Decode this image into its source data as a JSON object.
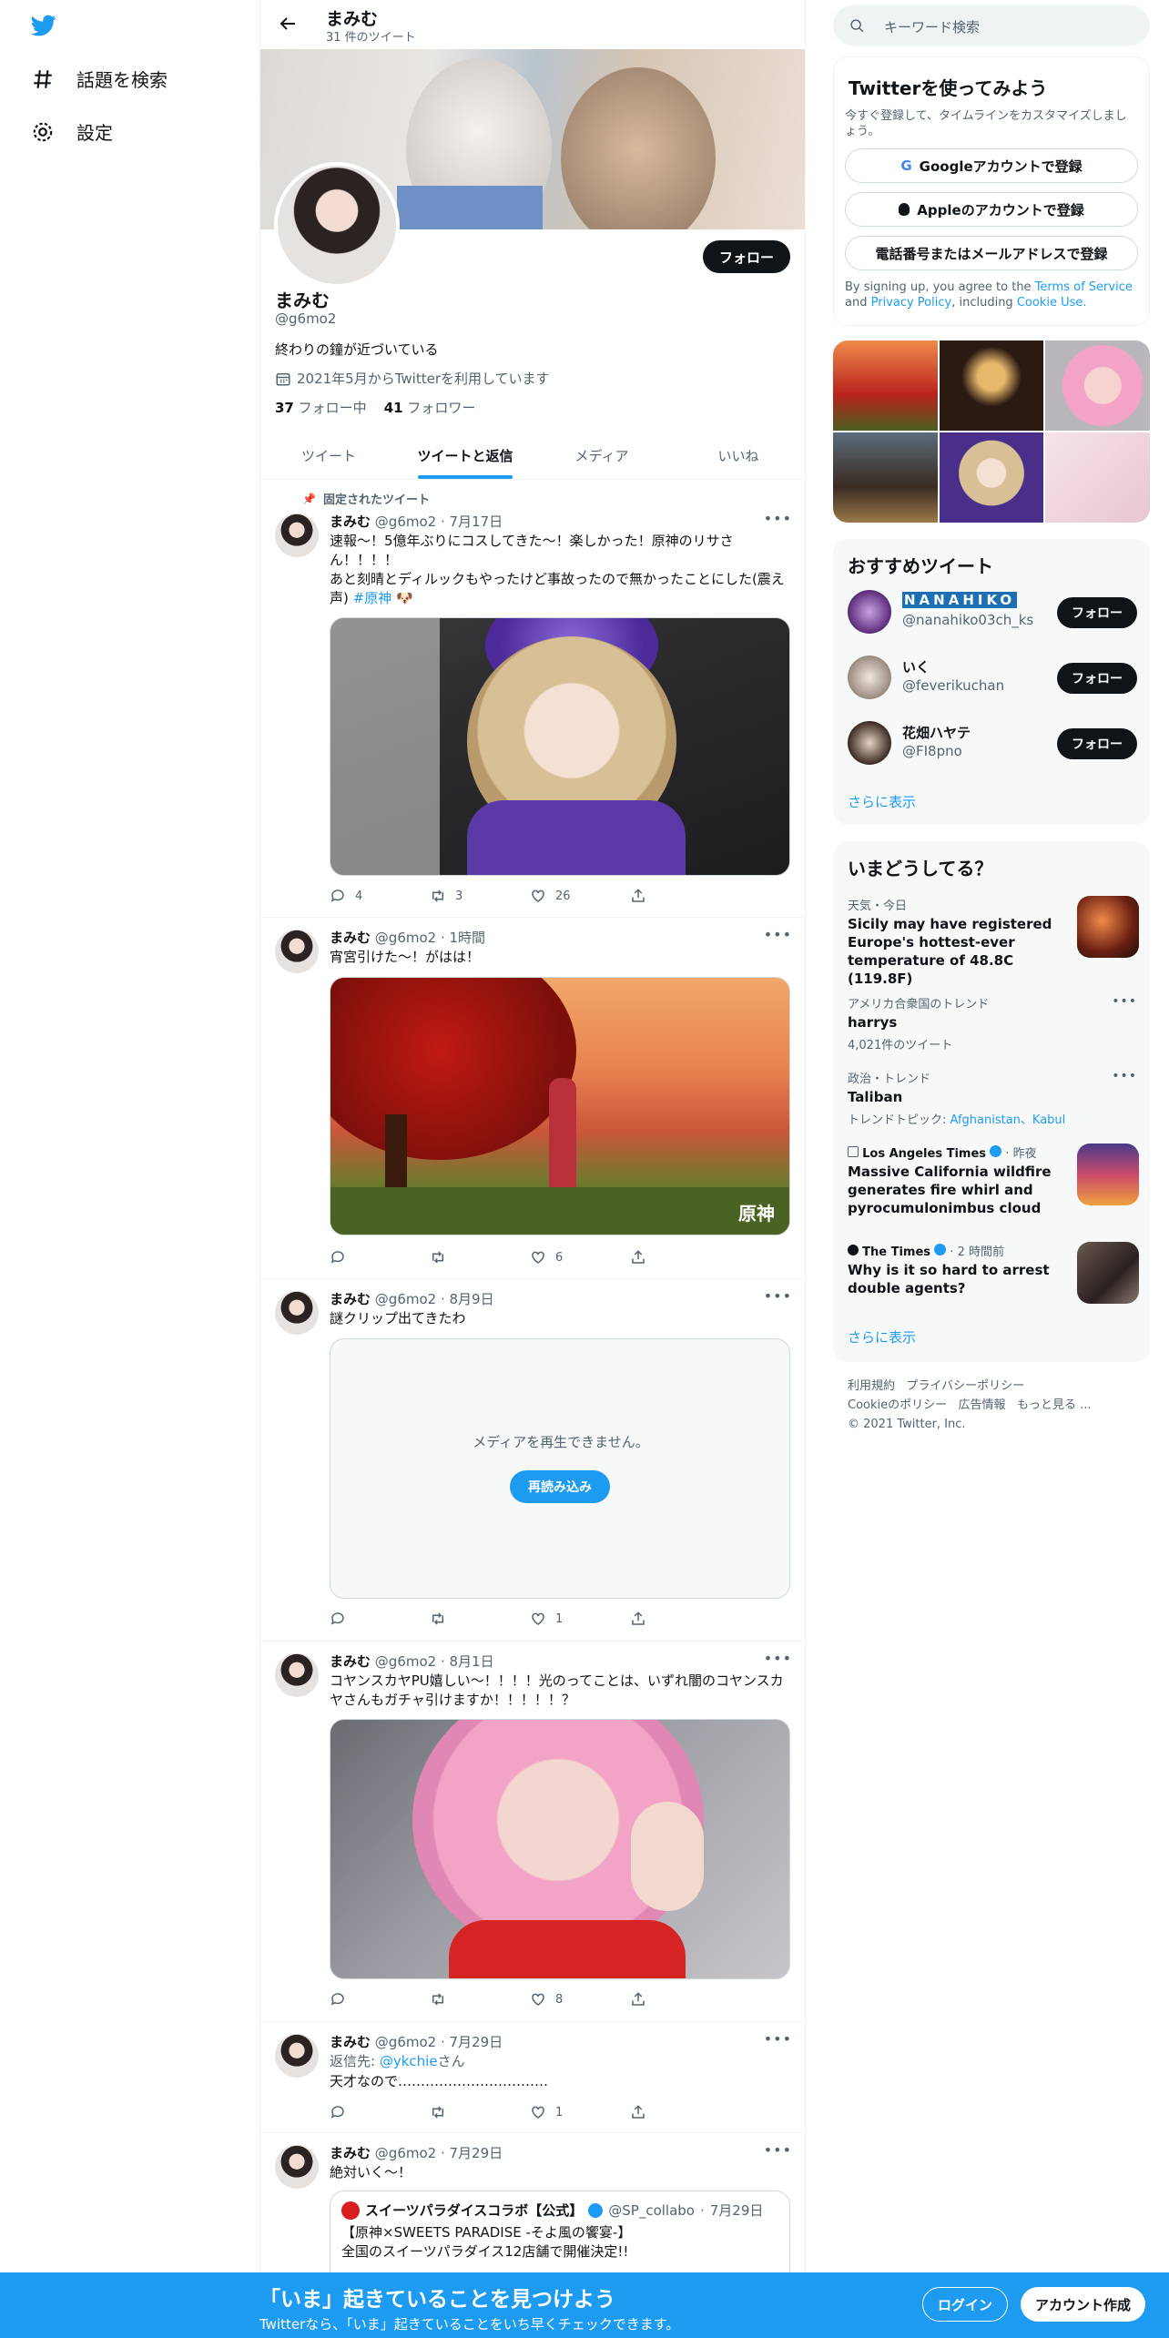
{
  "nav": {
    "explore": "話題を検索",
    "settings": "設定"
  },
  "header": {
    "name": "まみむ",
    "tweet_count": "31 件のツイート"
  },
  "profile": {
    "follow": "フォロー",
    "name": "まみむ",
    "handle": "@g6mo2",
    "bio": "終わりの鐘が近づいている",
    "joined": "2021年5月からTwitterを利用しています",
    "following_count": "37",
    "following_label": "フォロー中",
    "followers_count": "41",
    "followers_label": "フォロワー"
  },
  "tabs": [
    "ツイート",
    "ツイートと返信",
    "メディア",
    "いいね"
  ],
  "pinned_label": "固定されたツイート",
  "tweets": [
    {
      "name": "まみむ",
      "handle": "@g6mo2",
      "time": "7月17日",
      "text1": "速報〜！5億年ぶりにコスしてきた〜！楽しかった！原神のリサさん！！！！",
      "text2": "あと刻晴とディルックもやったけど事故ったので無かったことにした(震え声)",
      "hashtag": "#原神",
      "replies": "4",
      "retweets": "3",
      "likes": "26"
    },
    {
      "name": "まみむ",
      "handle": "@g6mo2",
      "time": "1時間",
      "text": "宵宮引けた〜！がはは！",
      "watermark": "原神",
      "replies": "",
      "retweets": "",
      "likes": "6"
    },
    {
      "name": "まみむ",
      "handle": "@g6mo2",
      "time": "8月9日",
      "text": "謎クリップ出てきたわ",
      "media_error": "メディアを再生できません。",
      "reload": "再読み込み",
      "replies": "",
      "retweets": "",
      "likes": "1"
    },
    {
      "name": "まみむ",
      "handle": "@g6mo2",
      "time": "8月1日",
      "text": "コヤンスカヤPU嬉しい〜！！！！光のってことは、いずれ闇のコヤンスカヤさんもガチャ引けますか！！！！！？",
      "replies": "",
      "retweets": "",
      "likes": "8"
    },
    {
      "name": "まみむ",
      "handle": "@g6mo2",
      "time": "7月29日",
      "reply_to_label": "返信先:",
      "reply_to": "@ykchie",
      "reply_suffix": "さん",
      "text": "天才なので……………………………",
      "replies": "",
      "retweets": "",
      "likes": "1"
    },
    {
      "name": "まみむ",
      "handle": "@g6mo2",
      "time": "7月29日",
      "text": "絶対いく〜！",
      "quote_name": "スイーツパラダイスコラボ【公式】",
      "quote_handle": "@SP_collabo",
      "quote_time": "7月29日",
      "quote_text1": "【原神×SWEETS PARADISE -そよ風の饗宴-】",
      "quote_text2": "全国のスイーツパラダイス12店舗で開催決定!!"
    }
  ],
  "search": {
    "placeholder": "キーワード検索"
  },
  "signup": {
    "title": "Twitterを使ってみよう",
    "subtitle": "今すぐ登録して、タイムラインをカスタマイズしましょう。",
    "google": "Googleアカウントで登録",
    "apple": "Appleのアカウントで登録",
    "phone": "電話番号またはメールアドレスで登録",
    "terms_prefix": "By signing up, you agree to the",
    "terms_link": "Terms of Service",
    "terms_and": "and",
    "privacy_link": "Privacy Policy",
    "terms_including": ", including",
    "cookie_link": "Cookie Use."
  },
  "recommended": {
    "title": "おすすめツイート",
    "follow": "フォロー",
    "users": [
      {
        "name": "NANAHIKO",
        "handle": "@nanahiko03ch_ks"
      },
      {
        "name": "いく",
        "handle": "@feverikuchan"
      },
      {
        "name": "花畑ハヤテ",
        "handle": "@FI8pno"
      }
    ],
    "show_more": "さらに表示"
  },
  "trends": {
    "title": "いまどうしてる？",
    "items": [
      {
        "meta": "天気・今日",
        "title": "Sicily may have registered Europe's hottest-ever temperature of 48.8C (119.8F)"
      },
      {
        "meta": "アメリカ合衆国のトレンド",
        "title": "harrys",
        "sub": "4,021件のツイート"
      },
      {
        "meta": "政治・トレンド",
        "title": "Taliban",
        "sub_label": "トレンドトピック:",
        "sub_link": "Afghanistan、Kabul"
      },
      {
        "source": "Los Angeles Times",
        "time": "昨夜",
        "title": "Massive California wildfire generates fire whirl and pyrocumulonimbus cloud"
      },
      {
        "source": "The Times",
        "time": "2 時間前",
        "title": "Why is it so hard to arrest double agents?"
      }
    ],
    "show_more": "さらに表示"
  },
  "footer": {
    "terms": "利用規約",
    "privacy": "プライバシーポリシー",
    "cookie": "Cookieのポリシー",
    "ads": "広告情報",
    "more": "もっと見る ...",
    "copyright": "© 2021 Twitter, Inc."
  },
  "bottom_bar": {
    "title": "「いま」起きていることを見つけよう",
    "subtitle": "Twitterなら、「いま」起きていることをいち早くチェックできます。",
    "login": "ログイン",
    "signup": "アカウント作成"
  },
  "colors": {
    "accent": "#1d9bf0",
    "text": "#0f1419",
    "muted": "#536471",
    "bottom_bar": "#1d9bf0"
  }
}
